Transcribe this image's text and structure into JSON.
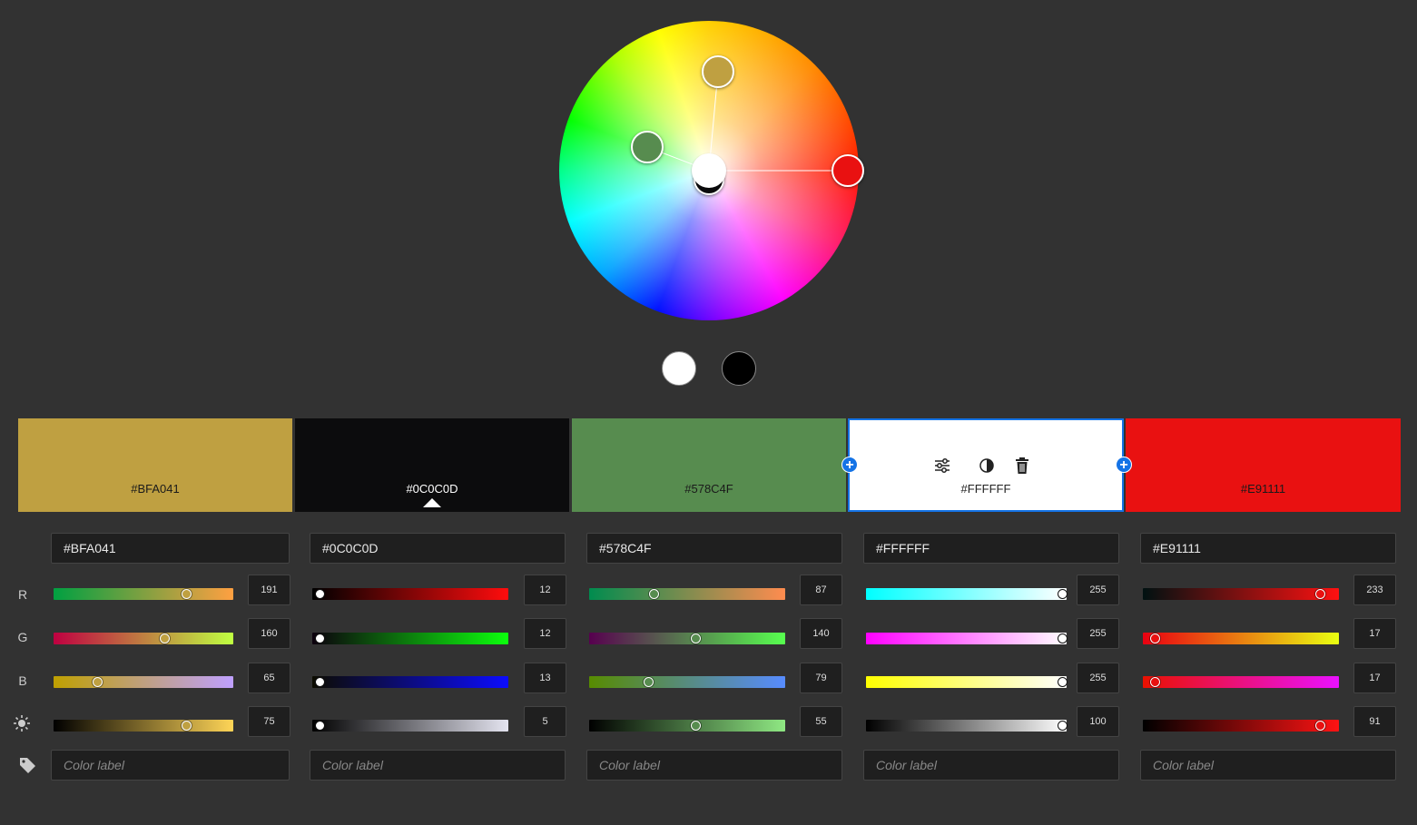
{
  "wheel": {
    "handles": [
      {
        "name": "gold",
        "color": "#BFA041"
      },
      {
        "name": "green",
        "color": "#578C4F"
      },
      {
        "name": "red",
        "color": "#E91111"
      },
      {
        "name": "white",
        "color": "#FFFFFF"
      },
      {
        "name": "black",
        "color": "#0C0C0D"
      }
    ]
  },
  "bw_swatches": [
    "#FFFFFF",
    "#000000"
  ],
  "swatches": [
    {
      "hex": "#BFA041"
    },
    {
      "hex": "#0C0C0D"
    },
    {
      "hex": "#578C4F"
    },
    {
      "hex": "#FFFFFF"
    },
    {
      "hex": "#E91111"
    }
  ],
  "swatch_tools": [
    "sliders-icon",
    "contrast-icon",
    "trash-icon"
  ],
  "rows": {
    "r": "R",
    "g": "G",
    "b": "B"
  },
  "columns": [
    {
      "hex": "#BFA041",
      "r": 191,
      "g": 160,
      "b": 65,
      "brightness": 75,
      "label_placeholder": "Color label"
    },
    {
      "hex": "#0C0C0D",
      "r": 12,
      "g": 12,
      "b": 13,
      "brightness": 5,
      "label_placeholder": "Color label"
    },
    {
      "hex": "#578C4F",
      "r": 87,
      "g": 140,
      "b": 79,
      "brightness": 55,
      "label_placeholder": "Color label"
    },
    {
      "hex": "#FFFFFF",
      "r": 255,
      "g": 255,
      "b": 255,
      "brightness": 100,
      "label_placeholder": "Color label"
    },
    {
      "hex": "#E91111",
      "r": 233,
      "g": 17,
      "b": 17,
      "brightness": 91,
      "label_placeholder": "Color label"
    }
  ]
}
